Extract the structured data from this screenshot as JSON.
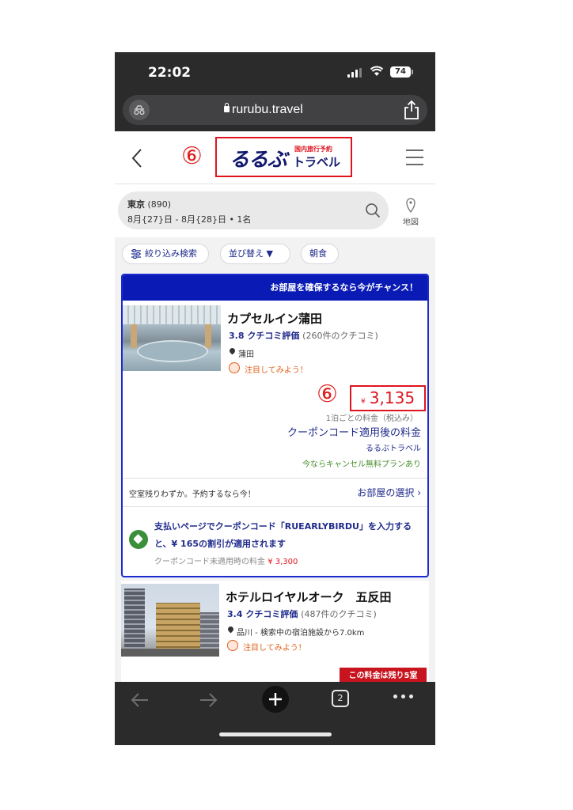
{
  "status_bar": {
    "time": "22:02",
    "battery": "74"
  },
  "browser": {
    "url": "rurubu.travel",
    "tab_count": "2"
  },
  "header": {
    "annotation": "⑥",
    "logo_main": "るるぶ",
    "logo_sub_small": "国内旅行予約",
    "logo_sub": "トラベル"
  },
  "search": {
    "destination": "東京",
    "count": "(890)",
    "dates_guests": "8月{27}日 - 8月{28}日 • 1名",
    "map_label": "地図"
  },
  "filters": {
    "refine": "絞り込み検索",
    "sort": "並び替え ▼",
    "breakfast": "朝食"
  },
  "hotel1": {
    "banner": "お部屋を確保するなら今がチャンス！",
    "name": "カプセルイン蒲田",
    "rating": "3.8 クチコミ評価",
    "reviews": "(260件のクチコミ)",
    "location": "蒲田",
    "notice": "注目してみよう！",
    "annotation": "⑥",
    "currency": "¥",
    "price": "3,135",
    "price_note": "1泊ごとの料金（税込み）",
    "coupon_price_label": "クーポンコード適用後の料金",
    "provider": "るるぶトラベル",
    "cancel_note": "今ならキャンセル無料プランあり",
    "rooms_left": "空室残りわずか。予約するなら今！",
    "room_select": "お部屋の選択 ›",
    "coupon_text": "支払いページでクーポンコード「RUEARLYBIRDU」を入力すると、¥ 165の割引が適用されます",
    "coupon_orig_label": "クーポンコード未適用時の料金",
    "coupon_orig_price": "¥ 3,300"
  },
  "hotel2": {
    "name": "ホテルロイヤルオーク　五反田",
    "rating": "3.4 クチコミ評価",
    "reviews": "(487件のクチコミ)",
    "location": "品川 - 検索中の宿泊施設から7.0km",
    "notice": "注目してみよう！",
    "remaining_badge": "この料金は残り5室"
  },
  "colors": {
    "brand_navy": "#12186e",
    "accent_red": "#e0141e",
    "link_blue": "#1f2a8c",
    "banner_blue": "#0a1bb5"
  }
}
